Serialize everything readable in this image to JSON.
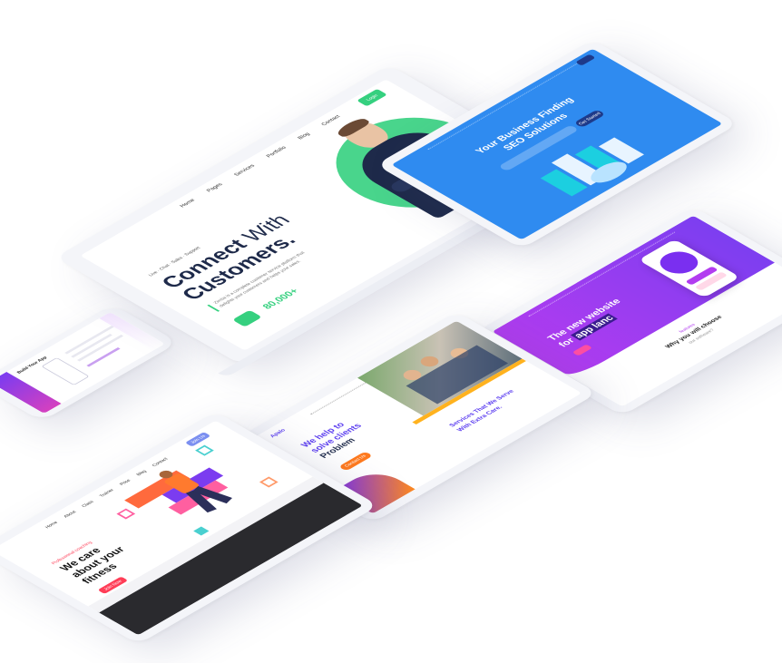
{
  "laptop": {
    "nav": [
      "Home",
      "Pages",
      "Services",
      "Portfolio",
      "Blog",
      "Contact"
    ],
    "cta": "Login",
    "tagline": "Live · Chat · Sales · Support",
    "headline_1": "Connect",
    "headline_2": "With",
    "headline_3": "Customers.",
    "body": "Zimba is a complete customer service platform that delights your customers and helps your sales.",
    "stat": "80,000+",
    "accent": "#35d07f",
    "navy": "#1e2a4a"
  },
  "seo": {
    "headline_1": "Your Business Finding",
    "headline_2": "SEO Solutions",
    "button": "Get Started",
    "color": "#2f8bf0"
  },
  "app": {
    "headline_1": "The new website",
    "headline_2": "for",
    "headline_3": "app lanc",
    "section_sub": "features",
    "section_title": "Why you will choose",
    "section_title_2": "our software?",
    "color": "#b23cf0"
  },
  "business": {
    "logo": "Apalo",
    "headline_1": "We help to",
    "headline_2": "solve clients",
    "headline_3": "Problem",
    "services_1": "Services That We Serve",
    "services_2": "With Extra Care.",
    "button": "Contact Us"
  },
  "fitness": {
    "kicker": "Professional coaching",
    "headline_1": "We care",
    "headline_2": "about your",
    "headline_3": "fitness",
    "button": "Join Now",
    "nav": [
      "Home",
      "About",
      "Class",
      "Trainer",
      "Price",
      "Blog",
      "Contact"
    ],
    "cta": "Join Us"
  },
  "phone": {
    "headline": "Build Your App"
  }
}
